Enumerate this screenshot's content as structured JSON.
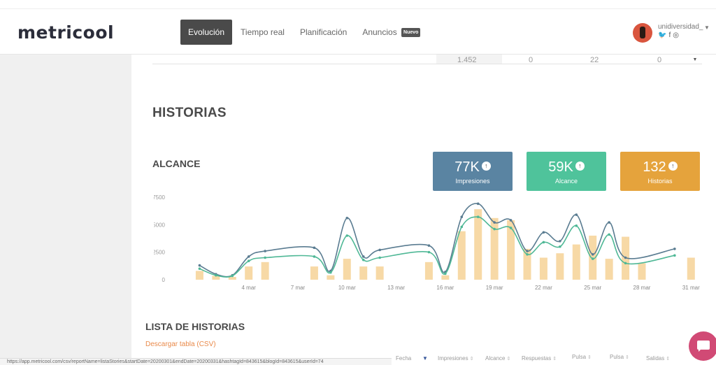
{
  "header": {
    "logo": "metricool",
    "nav": [
      {
        "label": "Evolución",
        "active": true
      },
      {
        "label": "Tiempo real",
        "active": false
      },
      {
        "label": "Planificación",
        "active": false
      },
      {
        "label": "Anuncios",
        "active": false
      }
    ],
    "new_badge": "Nuevo",
    "user": {
      "name": "unidiversidad_",
      "social_icons": [
        "twitter-icon",
        "facebook-icon",
        "instagram-icon"
      ]
    }
  },
  "cut_row": {
    "values": [
      "1.452",
      "0",
      "22",
      "0"
    ]
  },
  "section_title": "HISTORIAS",
  "reach_title": "ALCANCE",
  "kpis": [
    {
      "value": "77K",
      "label": "Impresiones",
      "color": "#5a84a2"
    },
    {
      "value": "59K",
      "label": "Alcance",
      "color": "#4fc39b"
    },
    {
      "value": "132",
      "label": "Historias",
      "color": "#e5a33c"
    }
  ],
  "chart_data": {
    "type": "line",
    "x_tick_labels": [
      "4 mar",
      "7 mar",
      "10 mar",
      "13 mar",
      "16 mar",
      "19 mar",
      "22 mar",
      "25 mar",
      "28 mar",
      "31 mar"
    ],
    "y_ticks": [
      0,
      2500,
      5000,
      7500
    ],
    "ylim": [
      0,
      8000
    ],
    "bar_color": "#f7d9a6",
    "series": [
      {
        "name": "Impresiones",
        "color": "#5a7c91",
        "points": [
          [
            1,
            1300
          ],
          [
            2,
            500
          ],
          [
            3,
            400
          ],
          [
            4,
            2100
          ],
          [
            5,
            2600
          ],
          [
            8,
            2900
          ],
          [
            9,
            800
          ],
          [
            10,
            5600
          ],
          [
            11,
            2100
          ],
          [
            12,
            2700
          ],
          [
            15,
            3100
          ],
          [
            16,
            700
          ],
          [
            17,
            5700
          ],
          [
            18,
            6900
          ],
          [
            19,
            5200
          ],
          [
            20,
            5400
          ],
          [
            21,
            2600
          ],
          [
            22,
            4300
          ],
          [
            23,
            3500
          ],
          [
            24,
            5900
          ],
          [
            25,
            2300
          ],
          [
            26,
            5200
          ],
          [
            27,
            2000
          ],
          [
            30,
            2800
          ]
        ]
      },
      {
        "name": "Alcance",
        "color": "#4fb896",
        "points": [
          [
            1,
            1000
          ],
          [
            2,
            400
          ],
          [
            3,
            350
          ],
          [
            4,
            1700
          ],
          [
            5,
            2000
          ],
          [
            8,
            2100
          ],
          [
            9,
            650
          ],
          [
            10,
            4000
          ],
          [
            11,
            1800
          ],
          [
            12,
            2000
          ],
          [
            15,
            2500
          ],
          [
            16,
            550
          ],
          [
            17,
            4800
          ],
          [
            18,
            5700
          ],
          [
            19,
            4600
          ],
          [
            20,
            4700
          ],
          [
            21,
            2300
          ],
          [
            22,
            3400
          ],
          [
            23,
            3000
          ],
          [
            24,
            4900
          ],
          [
            25,
            1900
          ],
          [
            26,
            4100
          ],
          [
            27,
            1500
          ],
          [
            30,
            2200
          ]
        ]
      }
    ],
    "bars": [
      [
        1,
        800
      ],
      [
        2,
        350
      ],
      [
        3,
        250
      ],
      [
        4,
        1200
      ],
      [
        5,
        1600
      ],
      [
        8,
        1200
      ],
      [
        9,
        400
      ],
      [
        10,
        1900
      ],
      [
        11,
        1200
      ],
      [
        12,
        1200
      ],
      [
        15,
        1600
      ],
      [
        16,
        400
      ],
      [
        17,
        4400
      ],
      [
        18,
        6400
      ],
      [
        19,
        5600
      ],
      [
        20,
        5400
      ],
      [
        21,
        2800
      ],
      [
        22,
        2000
      ],
      [
        23,
        2400
      ],
      [
        24,
        3200
      ],
      [
        25,
        4000
      ],
      [
        26,
        1900
      ],
      [
        27,
        3900
      ],
      [
        28,
        1500
      ],
      [
        31,
        2000
      ]
    ],
    "xlim": [
      0,
      31.5
    ]
  },
  "list_title": "LISTA DE HISTORIAS",
  "csv_link": "Descargar tabla (CSV)",
  "table_headers": [
    "Fecha",
    "Impresiones",
    "Alcance",
    "Respuestas",
    "Pulsa",
    "Pulsa",
    "Salidas"
  ],
  "status_url": "https://app.metricool.com/csv/reportName=listaStories&startDate=20200301&endDate=20200331&hashtagId=843615&blogId=843615&userId=74"
}
